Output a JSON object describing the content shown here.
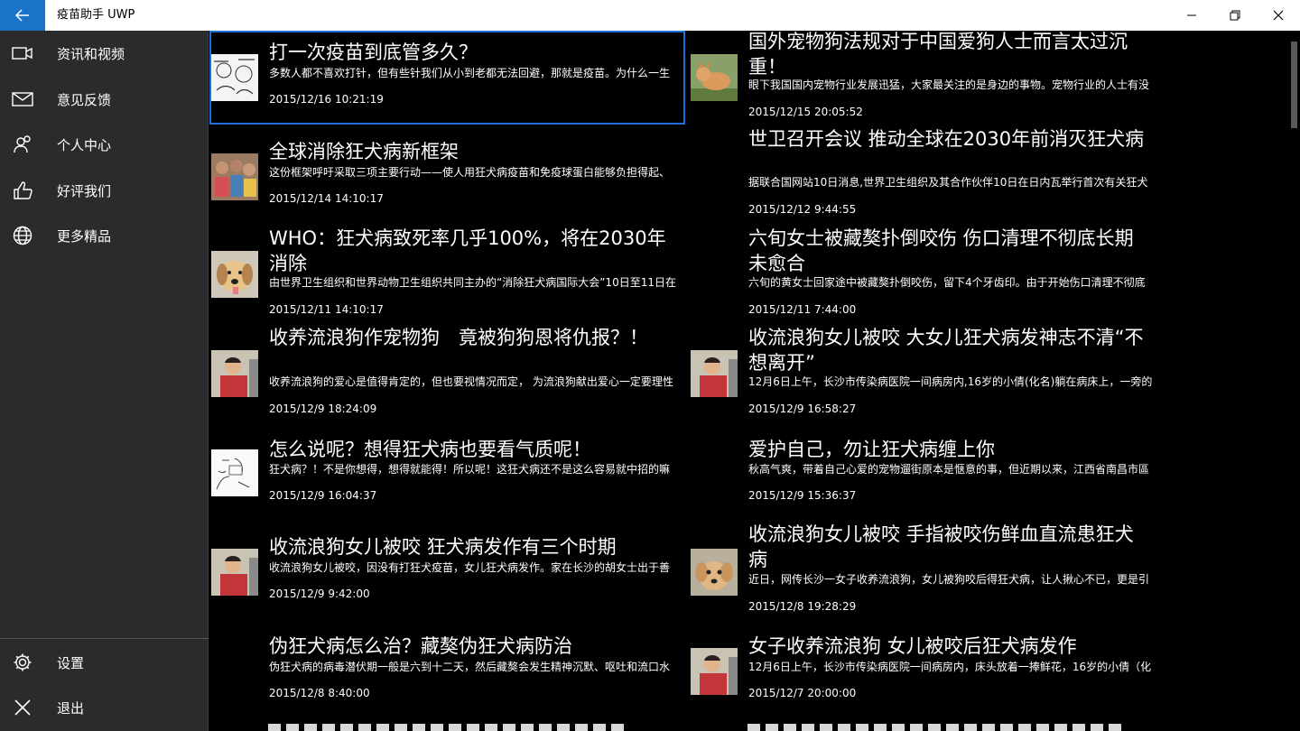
{
  "app": {
    "title": "疫苗助手 UWP",
    "accent": "#1a73c8"
  },
  "sidebar": {
    "items": [
      {
        "label": "资讯和视频",
        "icon": "video-camera-icon"
      },
      {
        "label": "意见反馈",
        "icon": "mail-icon"
      },
      {
        "label": "个人中心",
        "icon": "people-icon"
      },
      {
        "label": "好评我们",
        "icon": "thumbs-up-icon"
      },
      {
        "label": "更多精品",
        "icon": "globe-icon"
      }
    ],
    "bottom": [
      {
        "label": "设置",
        "icon": "gear-icon"
      },
      {
        "label": "退出",
        "icon": "close-icon"
      }
    ]
  },
  "articles": [
    {
      "title": "打一次疫苗到底管多久？",
      "summary": "多数人都不喜欢打针，但有些针我们从小到老都无法回避，那就是疫苗。为什么一生",
      "date": "2015/12/16 10:21:19",
      "thumb": "comic"
    },
    {
      "title": "国外宠物狗法规对于中国爱狗人士而言太过沉重！",
      "summary": "眼下我国国内宠物行业发展迅猛，大家最关注的是身边的事物。宠物行业的人士有没",
      "date": "2015/12/15 20:05:52",
      "thumb": "shiba"
    },
    {
      "title": "全球消除狂犬病新框架",
      "summary": "这份框架呼吁采取三项主要行动——使人用狂犬病疫苗和免疫球蛋白能够负担得起、",
      "date": "2015/12/14 14:10:17",
      "thumb": "kids"
    },
    {
      "title": "世卫召开会议 推动全球在2030年前消灭狂犬病",
      "summary": "据联合国网站10日消息,世界卫生组织及其合作伙伴10日在日内瓦举行首次有关狂犬",
      "date": "2015/12/12 9:44:55",
      "thumb": ""
    },
    {
      "title": "WHO：狂犬病致死率几乎100%，将在2030年消除",
      "summary": "由世界卫生组织和世界动物卫生组织共同主办的“消除狂犬病国际大会”10日至11日在",
      "date": "2015/12/11 14:10:17",
      "thumb": "dog"
    },
    {
      "title": "六旬女士被藏獒扑倒咬伤 伤口清理不彻底长期未愈合",
      "summary": "六旬的黄女士回家途中被藏獒扑倒咬伤，留下4个牙齿印。由于开始伤口清理不彻底",
      "date": "2015/12/11 7:44:00",
      "thumb": ""
    },
    {
      "title": "收养流浪狗作宠物狗　竟被狗狗恩将仇报？！",
      "summary": "收养流浪狗的爱心是值得肯定的，但也要视情况而定， 为流浪狗献出爱心一定要理性",
      "date": "2015/12/9 18:24:09",
      "thumb": "child"
    },
    {
      "title": "收流浪狗女儿被咬 大女儿狂犬病发神志不清“不想离开”",
      "summary": "12月6日上午，长沙市传染病医院一间病房内,16岁的小倩(化名)躺在病床上，一旁的",
      "date": "2015/12/9 16:58:27",
      "thumb": "child"
    },
    {
      "title": "怎么说呢？想得狂犬病也要看气质呢！",
      "summary": "狂犬病？！不是你想得，想得就能得！所以呢！这狂犬病还不是这么容易就中招的嘛",
      "date": "2015/12/9 16:04:37",
      "thumb": "sketch"
    },
    {
      "title": "爱护自己，勿让狂犬病缠上你",
      "summary": "秋高气爽，带着自己心爱的宠物遛街原本是惬意的事，但近期以来，江西省南昌市區",
      "date": "2015/12/9 15:36:37",
      "thumb": ""
    },
    {
      "title": "收流浪狗女儿被咬 狂犬病发作有三个时期",
      "summary": "收流浪狗女儿被咬，因没有打狂犬疫苗，女儿狂犬病发作。家在长沙的胡女士出于善",
      "date": "2015/12/9 9:42:00",
      "thumb": "child"
    },
    {
      "title": "收流浪狗女儿被咬 手指被咬伤鲜血直流患狂犬病",
      "summary": "近日，网传长沙一女子收养流浪狗，女儿被狗咬后得狂犬病，让人揪心不已，更是引",
      "date": "2015/12/8 19:28:29",
      "thumb": "puppy"
    },
    {
      "title": "伪狂犬病怎么治？藏獒伪狂犬病防治",
      "summary": "伪狂犬病的病毒潜伏期一般是六到十二天，然后藏獒会发生精神沉默、呕吐和流口水",
      "date": "2015/12/8 8:40:00",
      "thumb": ""
    },
    {
      "title": "女子收养流浪狗 女儿被咬后狂犬病发作",
      "summary": "12月6日上午，长沙市传染病医院一间病房内，床头放着一捧鲜花，16岁的小倩（化",
      "date": "2015/12/7 20:00:00",
      "thumb": "child"
    }
  ]
}
